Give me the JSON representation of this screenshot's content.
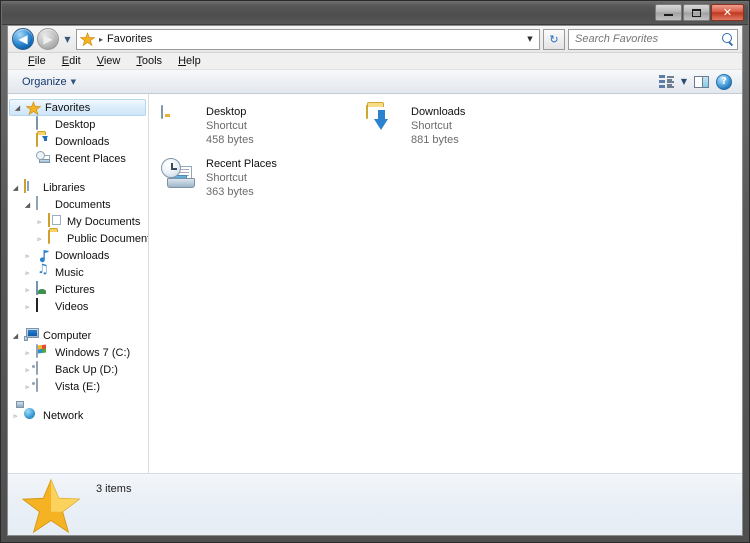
{
  "window": {
    "title": "",
    "controls": {
      "minimize": "minimize",
      "maximize": "restore",
      "close": "close",
      "minimize_glyph": "",
      "maximize_glyph": "",
      "close_glyph": "✕"
    }
  },
  "addressbar": {
    "back_label": "◀",
    "forward_label": "▶",
    "history_caret": "▼",
    "crumb_icon": "favorites-star",
    "separator": "▸",
    "path": "Favorites",
    "dropdown_caret": "▼",
    "refresh_glyph": "↻"
  },
  "search": {
    "placeholder": "Search Favorites",
    "value": "",
    "icon": "search-icon"
  },
  "menu": {
    "items": [
      {
        "accel": "F",
        "rest": "ile"
      },
      {
        "accel": "E",
        "rest": "dit"
      },
      {
        "accel": "V",
        "rest": "iew"
      },
      {
        "accel": "T",
        "rest": "ools"
      },
      {
        "accel": "H",
        "rest": "elp"
      }
    ]
  },
  "toolbar": {
    "organize_label": "Organize",
    "organize_caret": "▼",
    "view_caret": "▼",
    "help_glyph": "?"
  },
  "sidebar": {
    "items": [
      {
        "label": "Favorites",
        "indent": 0,
        "twisty": "open",
        "icon": "star",
        "selected": true
      },
      {
        "label": "Desktop",
        "indent": 1,
        "twisty": "none",
        "icon": "monitor",
        "selected": false
      },
      {
        "label": "Downloads",
        "indent": 1,
        "twisty": "none",
        "icon": "downloads",
        "selected": false
      },
      {
        "label": "Recent Places",
        "indent": 1,
        "twisty": "none",
        "icon": "recent",
        "selected": false
      },
      {
        "label": "",
        "indent": 0,
        "twisty": "gap",
        "icon": "gap",
        "selected": false
      },
      {
        "label": "Libraries",
        "indent": 0,
        "twisty": "open",
        "icon": "library",
        "selected": false
      },
      {
        "label": "Documents",
        "indent": 1,
        "twisty": "open",
        "icon": "document",
        "selected": false
      },
      {
        "label": "My Documents",
        "indent": 2,
        "twisty": "closed",
        "icon": "docfolder",
        "selected": false
      },
      {
        "label": "Public Documents",
        "indent": 2,
        "twisty": "closed",
        "icon": "folder",
        "selected": false
      },
      {
        "label": "Downloads",
        "indent": 1,
        "twisty": "closed",
        "icon": "music-dl",
        "selected": false
      },
      {
        "label": "Music",
        "indent": 1,
        "twisty": "closed",
        "icon": "music",
        "selected": false
      },
      {
        "label": "Pictures",
        "indent": 1,
        "twisty": "closed",
        "icon": "pictures",
        "selected": false
      },
      {
        "label": "Videos",
        "indent": 1,
        "twisty": "closed",
        "icon": "videos",
        "selected": false
      },
      {
        "label": "",
        "indent": 0,
        "twisty": "gap",
        "icon": "gap",
        "selected": false
      },
      {
        "label": "Computer",
        "indent": 0,
        "twisty": "open",
        "icon": "computer",
        "selected": false
      },
      {
        "label": "Windows 7 (C:)",
        "indent": 1,
        "twisty": "closed",
        "icon": "drive-windows",
        "selected": false
      },
      {
        "label": "Back Up (D:)",
        "indent": 1,
        "twisty": "closed",
        "icon": "drive",
        "selected": false
      },
      {
        "label": "Vista (E:)",
        "indent": 1,
        "twisty": "closed",
        "icon": "drive",
        "selected": false
      },
      {
        "label": "",
        "indent": 0,
        "twisty": "gap",
        "icon": "gap",
        "selected": false
      },
      {
        "label": "Network",
        "indent": 0,
        "twisty": "closed",
        "icon": "network",
        "selected": false
      }
    ]
  },
  "files": {
    "items": [
      {
        "name": "Desktop",
        "type": "Shortcut",
        "size": "458 bytes",
        "icon": "monitor-large"
      },
      {
        "name": "Downloads",
        "type": "Shortcut",
        "size": "881 bytes",
        "icon": "folder-downloads-large"
      },
      {
        "name": "Recent Places",
        "type": "Shortcut",
        "size": "363 bytes",
        "icon": "recent-places-large"
      }
    ]
  },
  "statusbar": {
    "icon": "favorites-star-large",
    "count_text": "3 items"
  },
  "colors": {
    "titlebar": "#525252",
    "accent_blue": "#2b82cf",
    "star_gold": "#f5b324",
    "close_red": "#c0371f",
    "selection": "#cfe6f9"
  }
}
